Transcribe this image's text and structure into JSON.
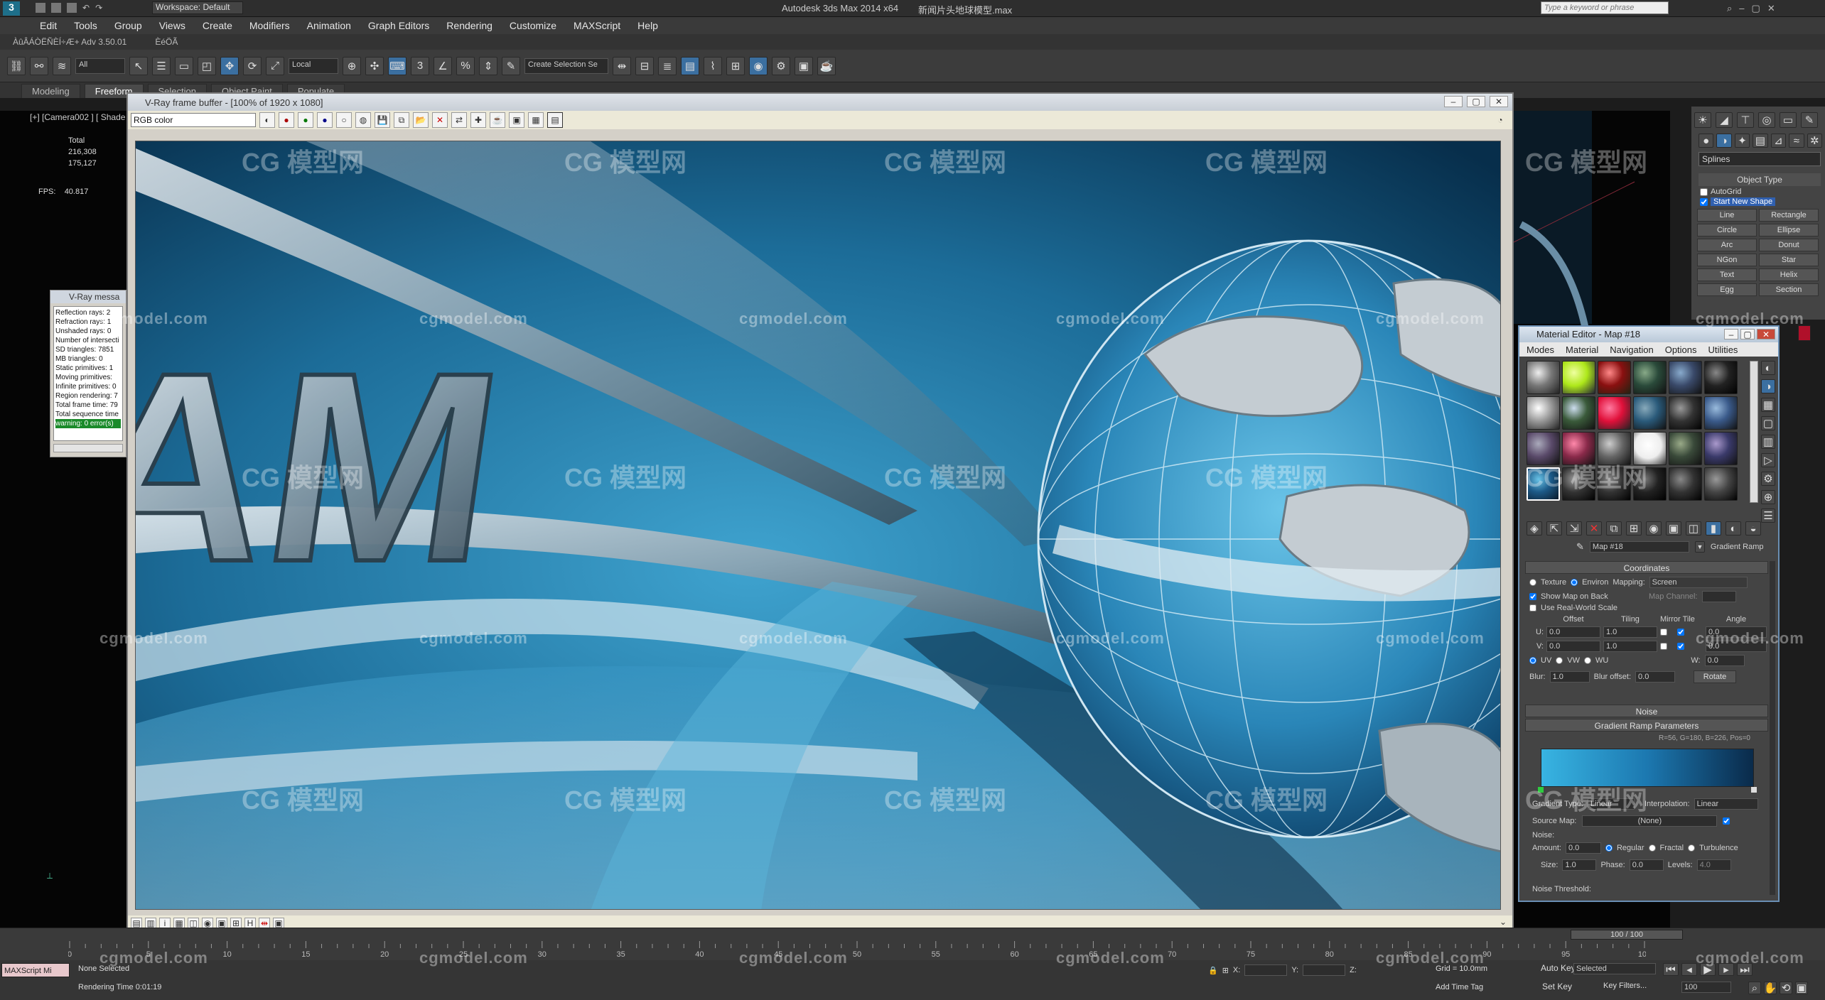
{
  "app": {
    "title": "Autodesk 3ds Max  2014 x64",
    "file": "新闻片头地球模型.max",
    "workspace": "Workspace: Default",
    "search_placeholder": "Type a keyword or phrase"
  },
  "menu": [
    "Edit",
    "Tools",
    "Group",
    "Views",
    "Create",
    "Modifiers",
    "Animation",
    "Graph Editors",
    "Rendering",
    "Customize",
    "MAXScript",
    "Help"
  ],
  "plugin_bar": [
    "ÀûÂÁÒËÑÈÍ÷Æ+ Adv 3.50.01",
    "ÈéÖÃ"
  ],
  "toolbar": {
    "selection_filter": "All",
    "ref_coord": "Local",
    "named_selection": "Create Selection Se"
  },
  "ribbon_tabs": [
    "Modeling",
    "Freeform",
    "Selection",
    "Object Paint",
    "Populate"
  ],
  "viewport": {
    "label": "[+] [Camera002 ] [ Shade",
    "stats_label": "Total",
    "stats_values": [
      "216,308",
      "175,127"
    ],
    "fps_label": "FPS:",
    "fps_value": "40.817"
  },
  "vfb": {
    "title": "V-Ray frame buffer - [100% of 1920 x 1080]",
    "channel": "RGB color",
    "render_text": "AM"
  },
  "vray_messages": {
    "title": "V-Ray messa",
    "lines": [
      "Reflection rays: 2",
      "Refraction rays: 1",
      "Unshaded rays: 0",
      "Number of intersecti",
      "SD triangles: 7851",
      "MB triangles: 0",
      "Static primitives: 1",
      "Moving primitives:",
      "Infinite primitives: 0",
      "Region rendering: 7",
      "Total frame time: 79",
      "Total sequence time",
      "warning: 0 error(s)"
    ]
  },
  "command_panel": {
    "dropdown": "Splines",
    "rollout": "Object Type",
    "autogrid": "AutoGrid",
    "start_new_shape": "Start New Shape",
    "buttons": [
      "Line",
      "Rectangle",
      "Circle",
      "Ellipse",
      "Arc",
      "Donut",
      "NGon",
      "Star",
      "Text",
      "Helix",
      "Egg",
      "Section"
    ]
  },
  "material_editor": {
    "title": "Material Editor - Map #18",
    "menu": [
      "Modes",
      "Material",
      "Navigation",
      "Options",
      "Utilities"
    ],
    "map_name": "Map #18",
    "map_type": "Gradient Ramp",
    "coordinates": {
      "header": "Coordinates",
      "texture": "Texture",
      "environ": "Environ",
      "mapping_label": "Mapping:",
      "mapping": "Screen",
      "show_map_on_back": "Show Map on Back",
      "map_channel": "Map Channel:",
      "use_real_world": "Use Real-World Scale",
      "col_offset": "Offset",
      "col_tiling": "Tiling",
      "col_mirror_tile": "Mirror Tile",
      "col_angle": "Angle",
      "u_label": "U:",
      "v_label": "V:",
      "w_label": "W:",
      "u_offset": "0.0",
      "v_offset": "0.0",
      "u_tiling": "1.0",
      "v_tiling": "1.0",
      "u_angle": "0.0",
      "v_angle": "0.0",
      "w_angle": "0.0",
      "uv": "UV",
      "vw": "VW",
      "wu": "WU",
      "blur_label": "Blur:",
      "blur": "1.0",
      "blur_offset_label": "Blur offset:",
      "blur_offset": "0.0",
      "rotate": "Rotate"
    },
    "noise_header": "Noise",
    "gradient_header": "Gradient Ramp Parameters",
    "gradient_readout": "R=56, G=180, B=226,  Pos=0",
    "gradient_type_label": "Gradient Type:",
    "gradient_type": "Linear",
    "interpolation_label": "Interpolation:",
    "interpolation": "Linear",
    "source_map_label": "Source Map:",
    "source_map": "(None)",
    "noise": {
      "section": "Noise:",
      "amount_label": "Amount:",
      "amount": "0.0",
      "regular": "Regular",
      "fractal": "Fractal",
      "turbulence": "Turbulence",
      "size_label": "Size:",
      "size": "1.0",
      "phase_label": "Phase:",
      "phase": "0.0",
      "levels_label": "Levels:",
      "levels": "4.0",
      "threshold": "Noise Threshold:"
    }
  },
  "timeline": {
    "frame": "100 / 100",
    "ticks": [
      "0",
      "5",
      "10",
      "15",
      "20",
      "25",
      "30",
      "35",
      "40",
      "45",
      "50",
      "55",
      "60",
      "65",
      "70",
      "75",
      "80",
      "85",
      "90",
      "95",
      "100"
    ]
  },
  "status": {
    "maxscript": "MAXScript Mi",
    "selected": "None Selected",
    "render_time": "Rendering Time  0:01:19",
    "x_label": "X:",
    "y_label": "Y:",
    "z_label": "Z:",
    "grid": "Grid = 10.0mm",
    "add_time_tag": "Add Time Tag",
    "auto_key": "Auto Key",
    "set_key": "Set Key",
    "key_mode": "Selected",
    "key_filters": "Key Filters...",
    "frame_value": "100"
  },
  "watermark": {
    "url": "cgmodel.com",
    "brand": "CG 模型网"
  }
}
